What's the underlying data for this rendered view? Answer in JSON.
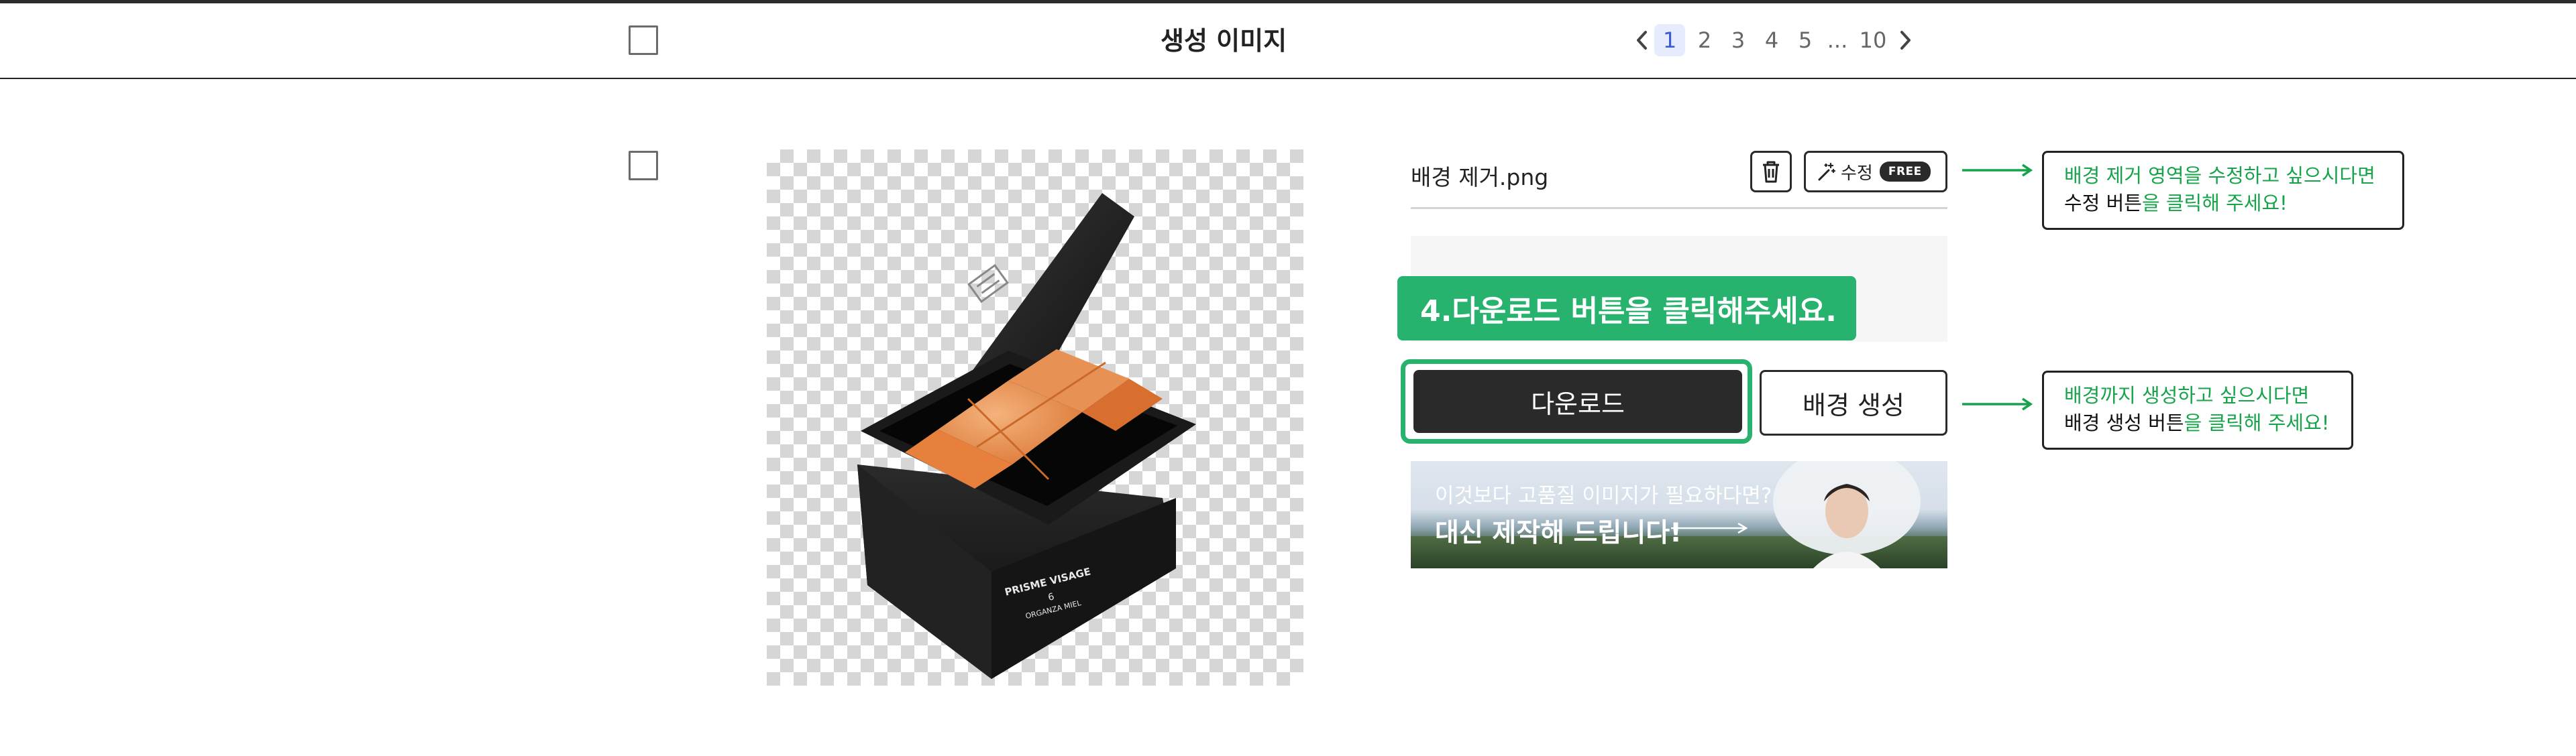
{
  "header": {
    "title": "생성 이미지",
    "pagination": {
      "pages": [
        "1",
        "2",
        "3",
        "4",
        "5"
      ],
      "current": "1",
      "ellipsis": "...",
      "last": "10"
    }
  },
  "file": {
    "name": "배경 제거.png",
    "edit_label": "수정",
    "free_badge": "FREE"
  },
  "step_tooltip": "4.다운로드 버튼을 클릭해주세요.",
  "actions": {
    "download_label": "다운로드",
    "generate_bg_label": "배경 생성"
  },
  "banner": {
    "subtitle": "이것보다 고품질 이미지가 필요하다면?",
    "title": "대신 제작해 드립니다!"
  },
  "callouts": {
    "edit": {
      "line1": "배경 제거 영역을 수정하고 싶으시다면",
      "line2_dark": "수정 버튼",
      "line2_green": "을 클릭해 주세요!"
    },
    "generate": {
      "line1": "배경까지 생성하고 싶으시다면",
      "line2_dark": "배경 생성 버튼",
      "line2_green": "을 클릭해 주세요!"
    }
  },
  "product": {
    "brand": "PRISME VISAGE",
    "number": "6",
    "shade": "ORGANZA MIEL"
  },
  "colors": {
    "accent_green": "#27b26e",
    "dark_button": "#2a2a2a",
    "active_page": "#3a5bd9"
  }
}
